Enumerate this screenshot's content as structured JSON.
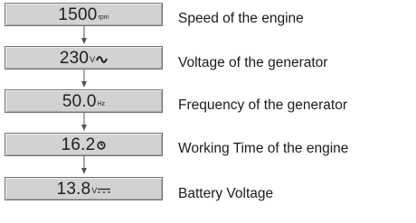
{
  "rows": [
    {
      "value": "1500",
      "unit": "rpm",
      "unit_icon": "",
      "label": "Speed of the engine"
    },
    {
      "value": "230",
      "unit": "V",
      "unit_icon": "ac-wave-icon",
      "label": "Voltage of the generator"
    },
    {
      "value": "50.0",
      "unit": "Hz",
      "unit_icon": "",
      "label": "Frequency of the generator"
    },
    {
      "value": "16.2",
      "unit": "",
      "unit_icon": "clock-icon",
      "label": "Working Time of the engine"
    },
    {
      "value": "13.8",
      "unit": "V",
      "unit_icon": "dc-symbol-icon",
      "label": "Battery Voltage"
    }
  ],
  "colors": {
    "box_fill": "#d2d2d2",
    "box_border": "#6f6f6f",
    "text": "#1a1a1a",
    "connector": "#555555"
  }
}
